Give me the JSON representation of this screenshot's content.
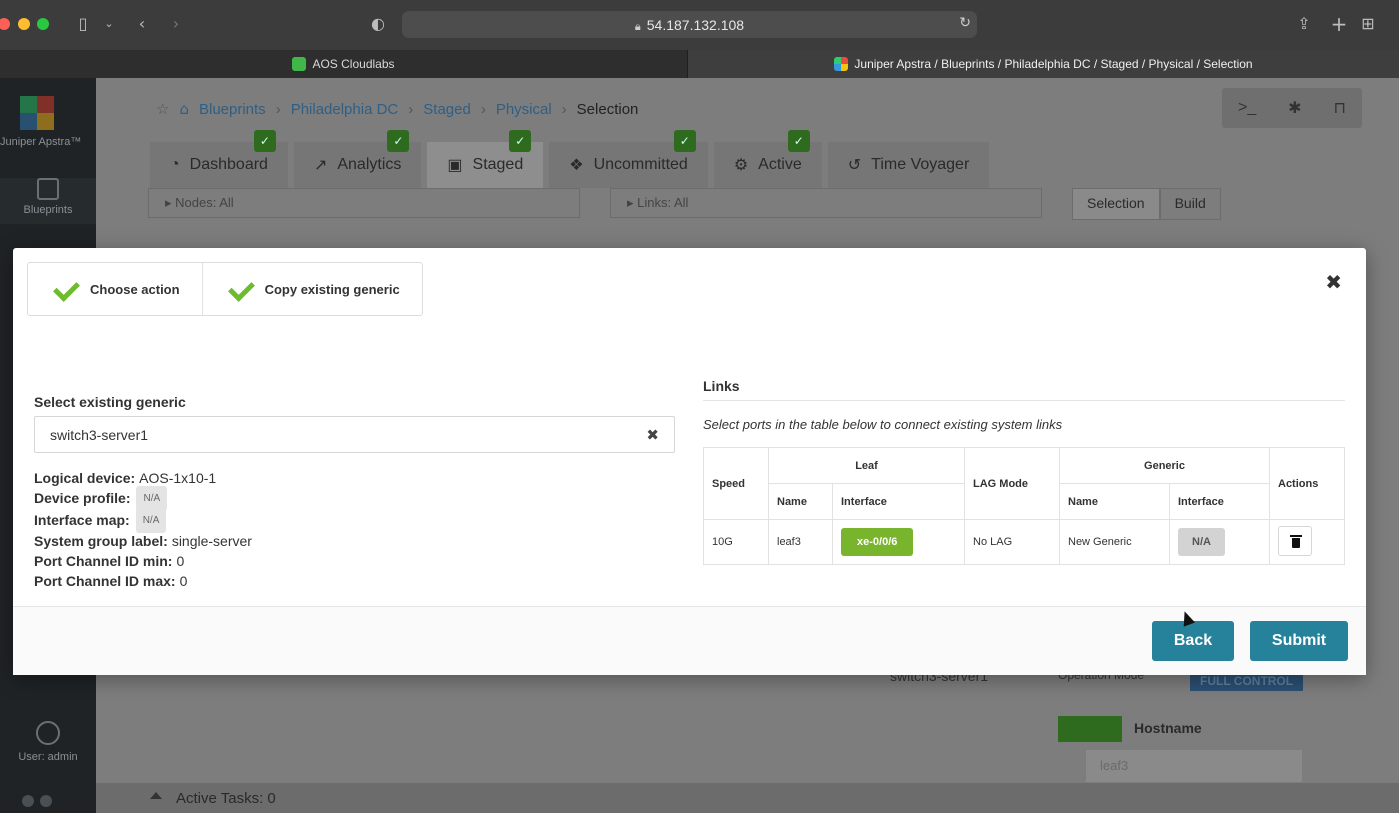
{
  "browser": {
    "url": "54.187.132.108",
    "tabs": [
      {
        "label": "AOS Cloudlabs"
      },
      {
        "label": "Juniper Apstra / Blueprints / Philadelphia DC / Staged / Physical / Selection"
      }
    ]
  },
  "sidebar": {
    "brand": "Juniper Apstra™",
    "blueprints_label": "Blueprints",
    "user_label": "User: admin"
  },
  "breadcrumb": [
    "Blueprints",
    "Philadelphia DC",
    "Staged",
    "Physical",
    "Selection"
  ],
  "app_tabs": [
    {
      "label": "Dashboard",
      "icon": "gauge-icon"
    },
    {
      "label": "Analytics",
      "icon": "chart-icon"
    },
    {
      "label": "Staged",
      "icon": "cube-icon"
    },
    {
      "label": "Uncommitted",
      "icon": "cubes-icon"
    },
    {
      "label": "Active",
      "icon": "gear-icon"
    },
    {
      "label": "Time Voyager",
      "icon": "history-icon"
    }
  ],
  "filters": {
    "nodes": "Nodes: All",
    "links": "Links: All"
  },
  "subtabs": [
    "Selection",
    "Build"
  ],
  "background": {
    "operation_mode_label": "Operation Mode",
    "operation_mode_value": "FULL CONTROL",
    "hostname_label": "Hostname",
    "hostname_value": "leaf3",
    "switch_label": "switch3-server1",
    "active_tasks": "Active Tasks: 0"
  },
  "modal": {
    "steps": [
      {
        "label": "Choose action"
      },
      {
        "label": "Copy existing generic"
      }
    ],
    "select_label": "Select existing generic",
    "select_value": "switch3-server1",
    "properties": {
      "logical_device": {
        "key": "Logical device:",
        "value": "AOS-1x10-1"
      },
      "device_profile": {
        "key": "Device profile:",
        "value": "N/A"
      },
      "interface_map": {
        "key": "Interface map:",
        "value": "N/A"
      },
      "system_group_label": {
        "key": "System group label:",
        "value": "single-server"
      },
      "port_channel_min": {
        "key": "Port Channel ID min:",
        "value": "0"
      },
      "port_channel_max": {
        "key": "Port Channel ID max:",
        "value": "0"
      }
    },
    "links": {
      "title": "Links",
      "subtitle": "Select ports in the table below to connect existing system links",
      "headers": {
        "speed": "Speed",
        "leaf": "Leaf",
        "lag_mode": "LAG Mode",
        "generic": "Generic",
        "actions": "Actions",
        "name": "Name",
        "interface": "Interface"
      },
      "rows": [
        {
          "speed": "10G",
          "leaf_name": "leaf3",
          "leaf_interface": "xe-0/0/6",
          "lag_mode": "No LAG",
          "generic_name": "New Generic",
          "generic_interface": "N/A"
        }
      ]
    },
    "buttons": {
      "back": "Back",
      "submit": "Submit"
    }
  },
  "colors": {
    "primary": "#26819a",
    "success": "#79b52c",
    "check": "#6ebb2e"
  }
}
